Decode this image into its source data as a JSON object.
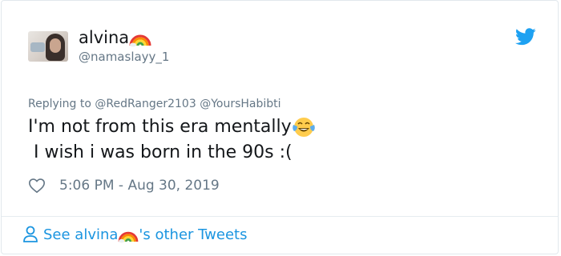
{
  "tweet": {
    "author": {
      "display_name": "alvina",
      "display_name_emoji": "rainbow-emoji",
      "handle": "@namaslayy_1"
    },
    "reply": {
      "prefix": "Replying to ",
      "mentions": [
        "@RedRanger2103",
        "@YoursHabibti"
      ]
    },
    "text": {
      "line1": "I'm not from this era mentally",
      "line1_emoji": "tears-of-joy-emoji",
      "line2": " I wish i was born in the 90s :("
    },
    "timestamp": "5:06 PM - Aug 30, 2019"
  },
  "footer": {
    "prefix": "See alvina",
    "suffix": "'s other Tweets"
  },
  "colors": {
    "link": "#1b95e0",
    "twitter_blue": "#1da1f2",
    "secondary_text": "#657786",
    "primary_text": "#14171a"
  }
}
